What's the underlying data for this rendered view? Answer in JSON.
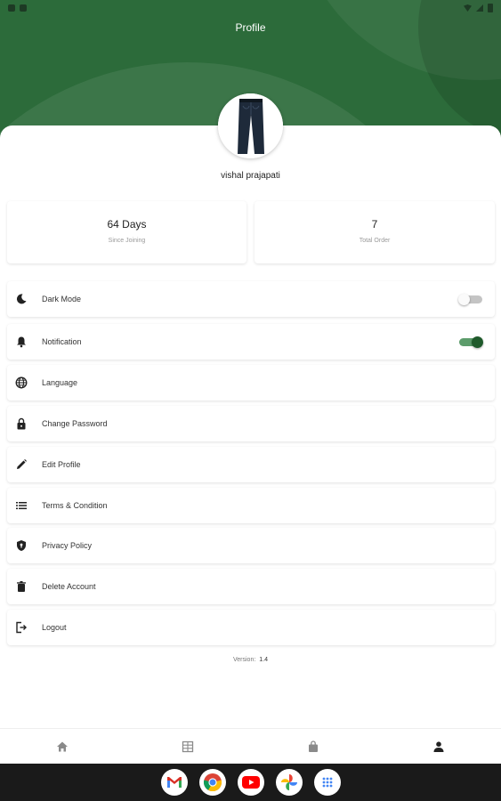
{
  "app": {
    "title": "Profile"
  },
  "profile": {
    "name": "vishal prajapati",
    "avatar_icon": "jeans-product-icon"
  },
  "stats": [
    {
      "value": "64 Days",
      "label": "Since Joining"
    },
    {
      "value": "7",
      "label": "Total Order"
    }
  ],
  "menu": [
    {
      "label": "Dark Mode",
      "icon": "moon-icon",
      "toggle": "off"
    },
    {
      "label": "Notification",
      "icon": "bell-icon",
      "toggle": "on"
    },
    {
      "label": "Language",
      "icon": "globe-icon"
    },
    {
      "label": "Change Password",
      "icon": "lock-icon"
    },
    {
      "label": "Edit Profile",
      "icon": "pencil-icon"
    },
    {
      "label": "Terms & Condition",
      "icon": "list-icon"
    },
    {
      "label": "Privacy Policy",
      "icon": "shield-icon"
    },
    {
      "label": "Delete Account",
      "icon": "trash-icon"
    },
    {
      "label": "Logout",
      "icon": "logout-icon"
    }
  ],
  "footer": {
    "version_label": "Version:",
    "version_number": "1.4"
  },
  "bottom_nav": [
    {
      "icon": "home-icon",
      "active": false
    },
    {
      "icon": "grid-icon",
      "active": false
    },
    {
      "icon": "bag-icon",
      "active": false
    },
    {
      "icon": "person-icon",
      "active": true
    }
  ],
  "dock_apps": [
    "gmail-icon",
    "chrome-icon",
    "youtube-icon",
    "photos-icon",
    "app-drawer-icon"
  ],
  "colors": {
    "primary": "#2c6b3a",
    "toggle_on": "#1f5a2b",
    "nav_active": "#222222",
    "nav_inactive": "#8a8a8a"
  }
}
